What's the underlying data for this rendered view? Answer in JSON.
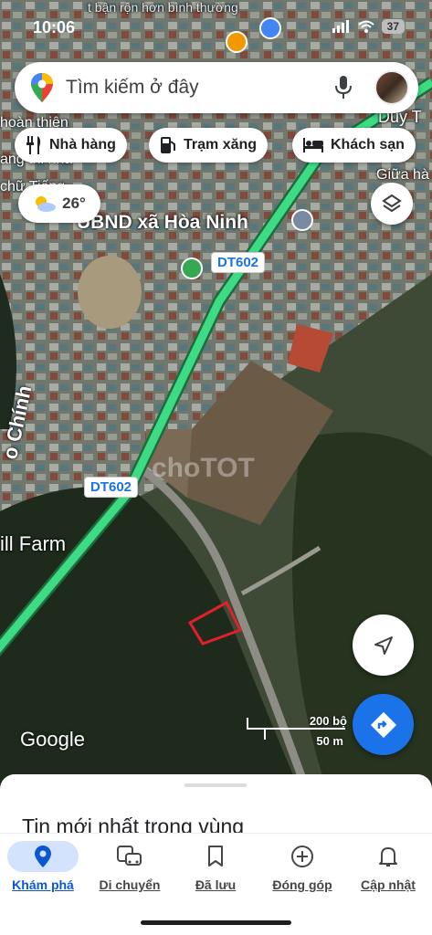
{
  "status": {
    "time": "10:06",
    "battery": "37"
  },
  "search": {
    "placeholder": "Tìm kiếm ở đây"
  },
  "chips": [
    {
      "label": "Nhà hàng",
      "icon": "restaurant-icon"
    },
    {
      "label": "Trạm xăng",
      "icon": "gas-station-icon"
    },
    {
      "label": "Khách sạn",
      "icon": "hotel-icon"
    }
  ],
  "weather": {
    "temperature": "26°"
  },
  "map_labels": {
    "place": "UBND xã Hòa Ninh",
    "road_top": "DT602",
    "road_bottom": "DT602",
    "street": "o Chính",
    "farm": "ill Farm",
    "top_right": "Duy T",
    "right_partial": "Giữa hà",
    "left_partial_1": "hoàn thiện",
    "left_partial_2": "ang thi nhà",
    "left_partial_3": "chữ Tiếng",
    "top_faint": "t bận rộn hơn bình thường",
    "watermark": "choTOT"
  },
  "scale": {
    "imperial": "200 bộ",
    "metric": "50 m"
  },
  "logo": "Google",
  "sheet": {
    "title": "Tin mới nhất trong vùng"
  },
  "nav": [
    {
      "label": "Khám phá",
      "icon": "location-pin-icon",
      "active": true
    },
    {
      "label": "Di chuyển",
      "icon": "commute-icon",
      "active": false
    },
    {
      "label": "Đã lưu",
      "icon": "bookmark-icon",
      "active": false
    },
    {
      "label": "Đóng góp",
      "icon": "add-circle-icon",
      "active": false
    },
    {
      "label": "Cập nhật",
      "icon": "bell-icon",
      "active": false
    }
  ],
  "colors": {
    "accent": "#0b57d0",
    "route_green": "#3ddc84",
    "parcel_red": "#e0202a",
    "directions_blue": "#1a73e8"
  }
}
